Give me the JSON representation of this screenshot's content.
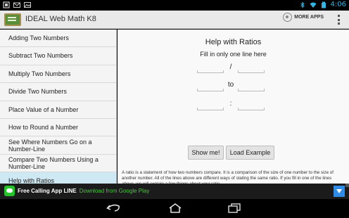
{
  "status": {
    "time": "4:06"
  },
  "app": {
    "title": "IDEAL Web Math K8",
    "more_apps": "MORE APPS"
  },
  "menu": [
    "Adding Two Numbers",
    "Subtract Two Numbers",
    "Multiply Two Numbers",
    "Divide Two Numbers",
    "Place Value of a Number",
    "How to Round a Number",
    "See Where Numbers Go on a Number-Line",
    "Compare Two Numbers Using a Number-Line",
    "Help with Ratios"
  ],
  "main": {
    "title": "Help with Ratios",
    "instruction": "Fill in only one line here",
    "separators": [
      "/",
      "to",
      ":"
    ],
    "show_button": "Show me!",
    "load_button": "Load Example",
    "explanation": "A ratio is a statement of how two numbers compare. It is a comparison of the size of one number to the size of another number. All of the lines above are different ways of stating the same ratio. If you fill in one of the lines above, we will explain a few things about your ratio."
  },
  "ad": {
    "app_name": "Free Calling App LINE",
    "cta": "Download from Google Play"
  },
  "icons": {
    "status_left": [
      "notification-icon",
      "gmail-icon",
      "image-icon"
    ],
    "status_right": [
      "bluetooth-icon",
      "wifi-icon",
      "battery-icon"
    ],
    "nav": [
      "back-icon",
      "home-icon",
      "recent-apps-icon"
    ]
  },
  "colors": {
    "selected_item": "#cfe9f4",
    "action_bar": "#e9e9e9",
    "ad_cta": "#46c83c",
    "status_time": "#33b5e5"
  }
}
